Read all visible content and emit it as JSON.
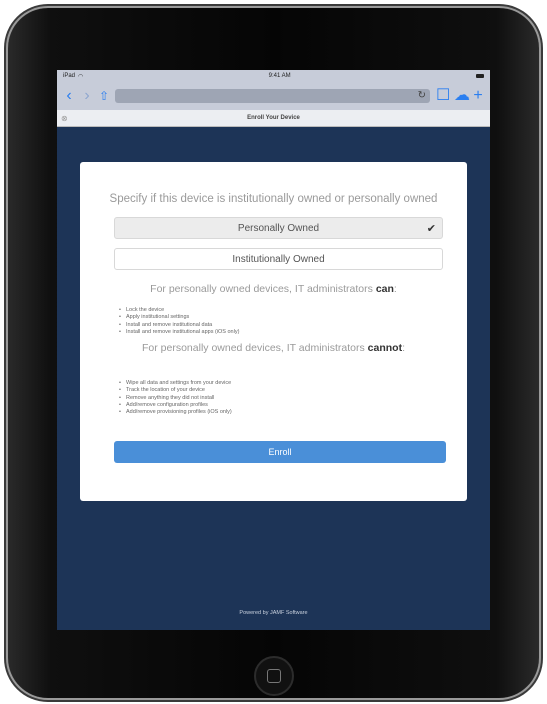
{
  "status": {
    "carrier": "iPad",
    "time": "9:41 AM"
  },
  "browser": {
    "back": "‹",
    "forward": "›",
    "share": "⇧",
    "reload": "↻",
    "bookmarks": "☐",
    "cloud": "☁",
    "add": "+",
    "tab_close": "⊗",
    "tab_title": "Enroll Your Device"
  },
  "card": {
    "heading": "Specify if this device is institutionally owned or personally owned",
    "option_personal": "Personally Owned",
    "option_institutional": "Institutionally Owned",
    "selected": "personal",
    "can_prefix": "For personally owned devices, IT administrators ",
    "can_word": "can",
    "can_suffix": ":",
    "can_items": [
      "Lock the device",
      "Apply institutional settings",
      "Install and remove institutional data",
      "Install and remove institutional apps (iOS only)"
    ],
    "cannot_prefix": "For personally owned devices, IT administrators ",
    "cannot_word": "cannot",
    "cannot_suffix": ":",
    "cannot_items": [
      "Wipe all data and settings from your device",
      "Track the location of your device",
      "Remove anything they did not install",
      "Add/remove configuration profiles",
      "Add/remove provisioning profiles (iOS only)"
    ],
    "enroll": "Enroll"
  },
  "footer": "Powered by JAMF Software",
  "colors": {
    "accent": "#4a8fd8",
    "background": "#1d3457"
  }
}
